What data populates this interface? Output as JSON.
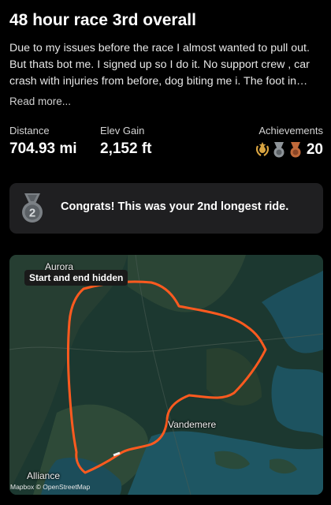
{
  "activity": {
    "title": "48 hour race 3rd overall",
    "description": "Due to my issues before the race I almost wanted to pull out. But thats bot me. I signed up so I do it. No support crew , car crash with injuries from before, dog biting me i. The foot in…",
    "read_more": "Read more..."
  },
  "stats": {
    "distance": {
      "label": "Distance",
      "value": "704.93 mi"
    },
    "elev_gain": {
      "label": "Elev Gain",
      "value": "2,152 ft"
    },
    "achievements": {
      "label": "Achievements",
      "count": "20",
      "icons": [
        "gold-laurel-icon",
        "silver-medal-icon",
        "bronze-medal-icon"
      ],
      "colors": {
        "gold": "#d9a441",
        "silver": "#8e9499",
        "bronze": "#c0693a"
      }
    }
  },
  "congrats": {
    "medal_number": "2",
    "message": "Congrats! This was your 2nd longest ride.",
    "icon": "silver-medal-icon"
  },
  "map": {
    "privacy_badge": "Start and end hidden",
    "labels": {
      "aurora": "Aurora",
      "vandemere": "Vandemere",
      "alliance": "Alliance"
    },
    "attribution": "Mapbox © OpenStreetMap",
    "route_color": "#ff5a1f"
  }
}
